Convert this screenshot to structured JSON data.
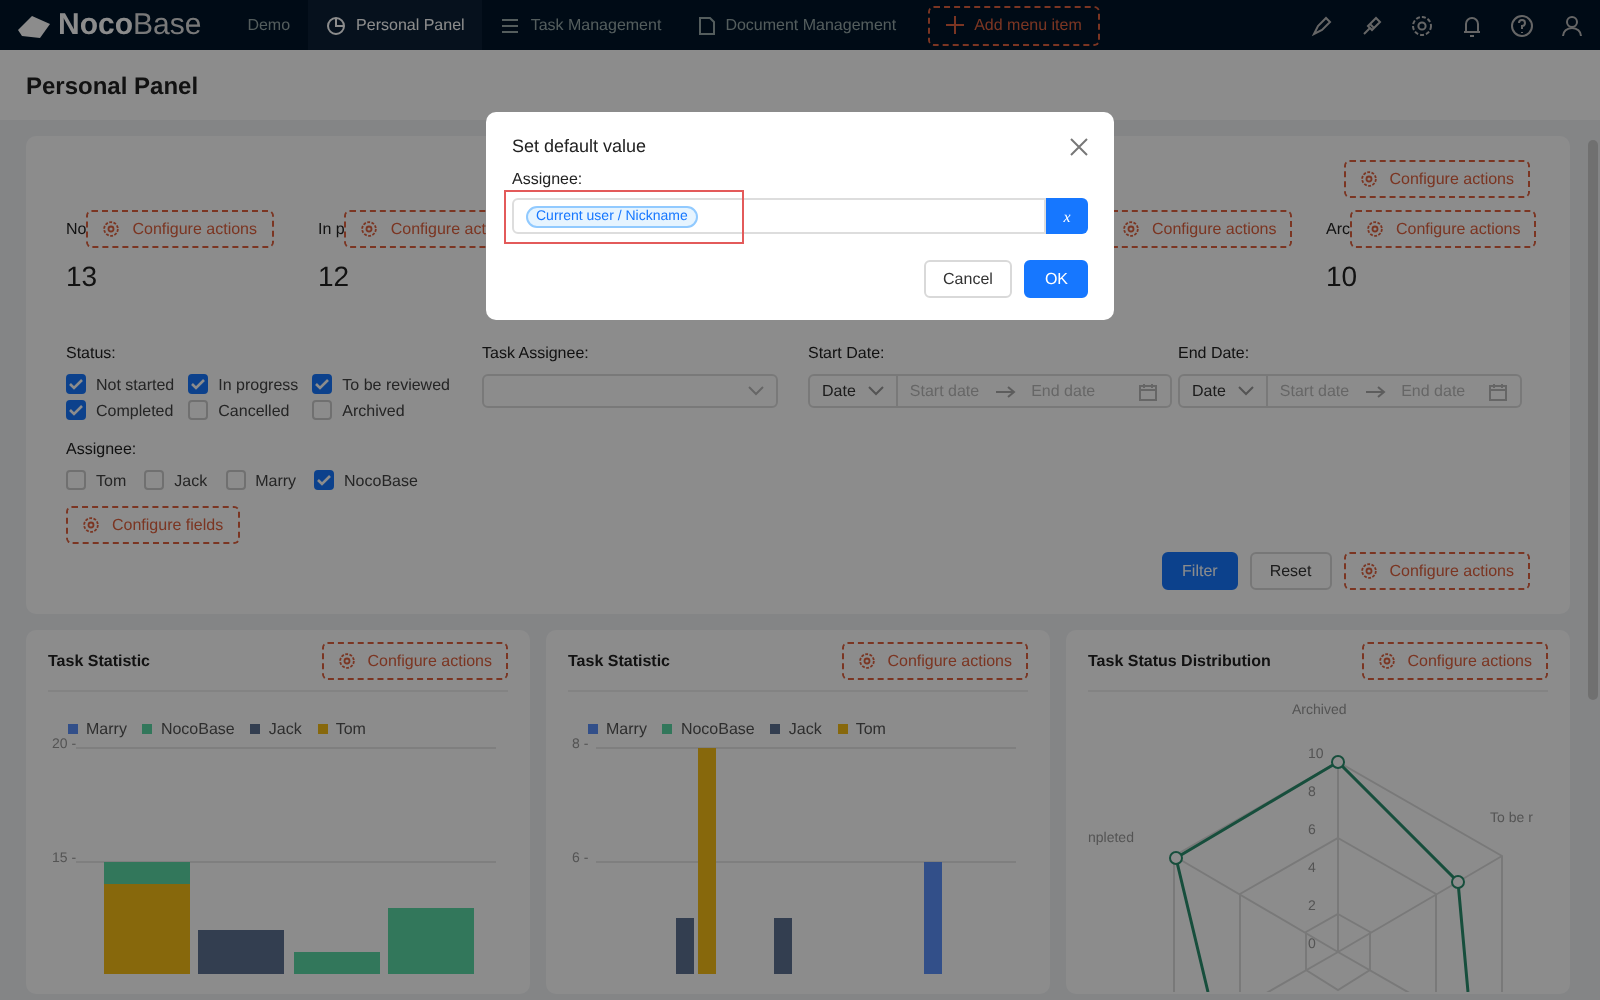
{
  "nav": {
    "logo_bold": "Noco",
    "logo_light": "Base",
    "items": [
      {
        "label": "Demo",
        "selected": false
      },
      {
        "label": "Personal Panel",
        "selected": true
      },
      {
        "label": "Task Management",
        "selected": false
      },
      {
        "label": "Document Management",
        "selected": false
      }
    ],
    "add_item": "Add menu item"
  },
  "page_title": "Personal Panel",
  "top_action": "Configure actions",
  "stats_left": [
    {
      "label": "No",
      "value": "13",
      "action": "Configure actions"
    },
    {
      "label": "In p",
      "value": "12",
      "action": "Configure acti"
    }
  ],
  "stats_right": [
    {
      "action": "Configure actions"
    },
    {
      "label": "Arc",
      "value": "10",
      "action": "Configure actions"
    }
  ],
  "filter": {
    "status": {
      "label": "Status:",
      "options": [
        {
          "label": "Not started",
          "checked": true
        },
        {
          "label": "In progress",
          "checked": true
        },
        {
          "label": "To be reviewed",
          "checked": true
        },
        {
          "label": "Completed",
          "checked": true
        },
        {
          "label": "Cancelled",
          "checked": false
        },
        {
          "label": "Archived",
          "checked": false
        }
      ]
    },
    "task_assignee": {
      "label": "Task Assignee:"
    },
    "dates": [
      {
        "label": "Start Date:",
        "mode": "Date",
        "start_placeholder": "Start date",
        "end_placeholder": "End date"
      },
      {
        "label": "End Date:",
        "mode": "Date",
        "start_placeholder": "Start date",
        "end_placeholder": "End date"
      }
    ],
    "assignee": {
      "label": "Assignee:",
      "options": [
        {
          "label": "Tom",
          "checked": false
        },
        {
          "label": "Jack",
          "checked": false
        },
        {
          "label": "Marry",
          "checked": false
        },
        {
          "label": "NocoBase",
          "checked": true
        }
      ]
    },
    "configure_fields": "Configure fields",
    "buttons": [
      "Filter",
      "Reset"
    ],
    "action": "Configure actions"
  },
  "charts": [
    {
      "kind": "bar1",
      "title": "Task Statistic",
      "action": "Configure actions",
      "legend": [
        {
          "name": "Marry",
          "color": "#324f89"
        },
        {
          "name": "NocoBase",
          "color": "#32775b"
        },
        {
          "name": "Jack",
          "color": "#333e50"
        },
        {
          "name": "Tom",
          "color": "#87680c"
        }
      ],
      "ticks": [
        "20 -",
        "15 -"
      ]
    },
    {
      "kind": "bar2",
      "title": "Task Statistic",
      "action": "Configure actions",
      "legend": [
        {
          "name": "Marry",
          "color": "#324f89"
        },
        {
          "name": "NocoBase",
          "color": "#32775b"
        },
        {
          "name": "Jack",
          "color": "#333e50"
        },
        {
          "name": "Tom",
          "color": "#87680c"
        }
      ],
      "ticks": [
        "8 -",
        "6 -"
      ]
    },
    {
      "kind": "radar",
      "title": "Task Status Distribution",
      "action": "Configure actions",
      "axes": [
        "Archived",
        "To be r",
        "npleted"
      ],
      "ticks": [
        "10",
        "8",
        "6",
        "4",
        "2",
        "0"
      ]
    }
  ],
  "modal": {
    "title": "Set default value",
    "field_label": "Assignee:",
    "tag": "Current user / Nickname",
    "variable_button": "x",
    "buttons": [
      "Cancel",
      "OK"
    ]
  }
}
